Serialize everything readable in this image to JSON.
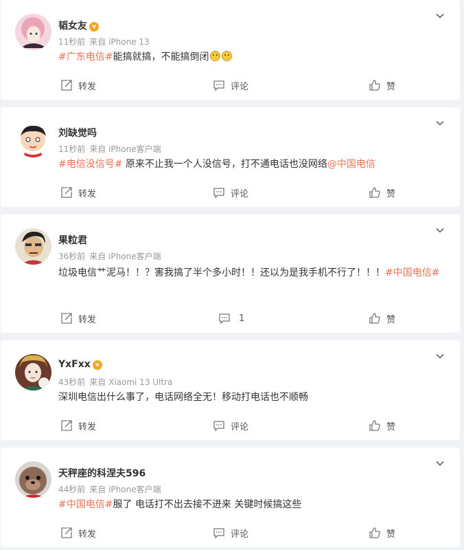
{
  "colors": {
    "accent": "#eb7350",
    "text": "#333333",
    "meta": "#999999",
    "bg": "#f1f2f5"
  },
  "icons": {
    "repost": "repost-icon",
    "comment": "comment-icon",
    "like": "like-icon",
    "menu": "chevron-down-icon",
    "vip": "vip-badge-icon"
  },
  "posts": [
    {
      "username": "韬女友",
      "time": "11秒前",
      "source": "来自 iPhone 13",
      "content": {
        "tag": "#广东电信#",
        "text": "能搞就搞，不能搞倒闭"
      },
      "actions": {
        "repost": "转发",
        "comment": "评论",
        "like": "赞"
      }
    },
    {
      "username": "刘缺觉吗",
      "time": "11秒前",
      "source": "来自 iPhone客户端",
      "content": {
        "tag": "#电信没信号#",
        "text": " 原来不止我一个人没信号，打不通电话也没网络",
        "mention": "@中国电信"
      },
      "actions": {
        "repost": "转发",
        "comment": "评论",
        "like": "赞"
      }
    },
    {
      "username": "果粒君",
      "time": "36秒前",
      "source": "来自 iPhone客户端",
      "content": {
        "text": "垃圾电信艹泥马！！？害我搞了半个多小时！！还以为是我手机不行了！！！",
        "tag": "#中国电信#"
      },
      "actions": {
        "repost": "转发",
        "comment": "1",
        "like": "赞"
      }
    },
    {
      "username": "YxFxx",
      "time": "43秒前",
      "source": "来自 Xiaomi 13 Ultra",
      "content": {
        "text": "深圳电信出什么事了，电话网络全无！移动打电话也不顺畅"
      },
      "actions": {
        "repost": "转发",
        "comment": "评论",
        "like": "赞"
      }
    },
    {
      "username": "天秤座的科涅夫596",
      "time": "44秒前",
      "source": "来自 iPhone客户端",
      "content": {
        "tag": "#中国电信#",
        "text": "服了 电话打不出去接不进来 关键时候搞这些"
      },
      "actions": {
        "repost": "转发",
        "comment": "评论",
        "like": "赞"
      }
    }
  ]
}
